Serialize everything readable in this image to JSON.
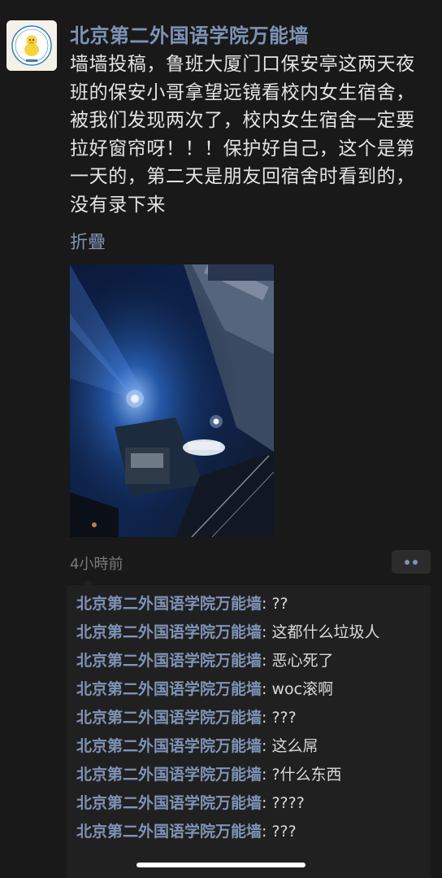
{
  "post": {
    "author": "北京第二外国语学院万能墙",
    "text": "墙墙投稿，鲁班大厦门口保安亭这两天夜班的保安小哥拿望远镜看校内女生宿舍，被我们发现两次了，校内女生宿舍一定要拉好窗帘呀！！！保护好自己，这个是第一天的，第二天是朋友回宿舍时看到的，没有录下来",
    "collapse_label": "折疊",
    "timestamp": "4小時前"
  },
  "icons": {
    "avatar": "duck-avatar-icon",
    "more": "more-dots-icon"
  },
  "comments": [
    {
      "author": "北京第二外国语学院万能墙",
      "sep": ": ",
      "text": "??"
    },
    {
      "author": "北京第二外国语学院万能墙",
      "sep": ": ",
      "text": "这都什么垃圾人"
    },
    {
      "author": "北京第二外国语学院万能墙",
      "sep": ": ",
      "text": "恶心死了"
    },
    {
      "author": "北京第二外国语学院万能墙",
      "sep": ": ",
      "text": "woc滚啊"
    },
    {
      "author": "北京第二外国语学院万能墙",
      "sep": ": ",
      "text": "???"
    },
    {
      "author": "北京第二外国语学院万能墙",
      "sep": ": ",
      "text": "这么屌"
    },
    {
      "author": "北京第二外国语学院万能墙",
      "sep": ": ",
      "text": "?什么东西"
    },
    {
      "author": "北京第二外国语学院万能墙",
      "sep": ": ",
      "text": "????"
    },
    {
      "author": "北京第二外国语学院万能墙",
      "sep": ": ",
      "text": "???"
    }
  ],
  "colors": {
    "background": "#191919",
    "link": "#7f93b6",
    "comment_bg": "#202020"
  }
}
